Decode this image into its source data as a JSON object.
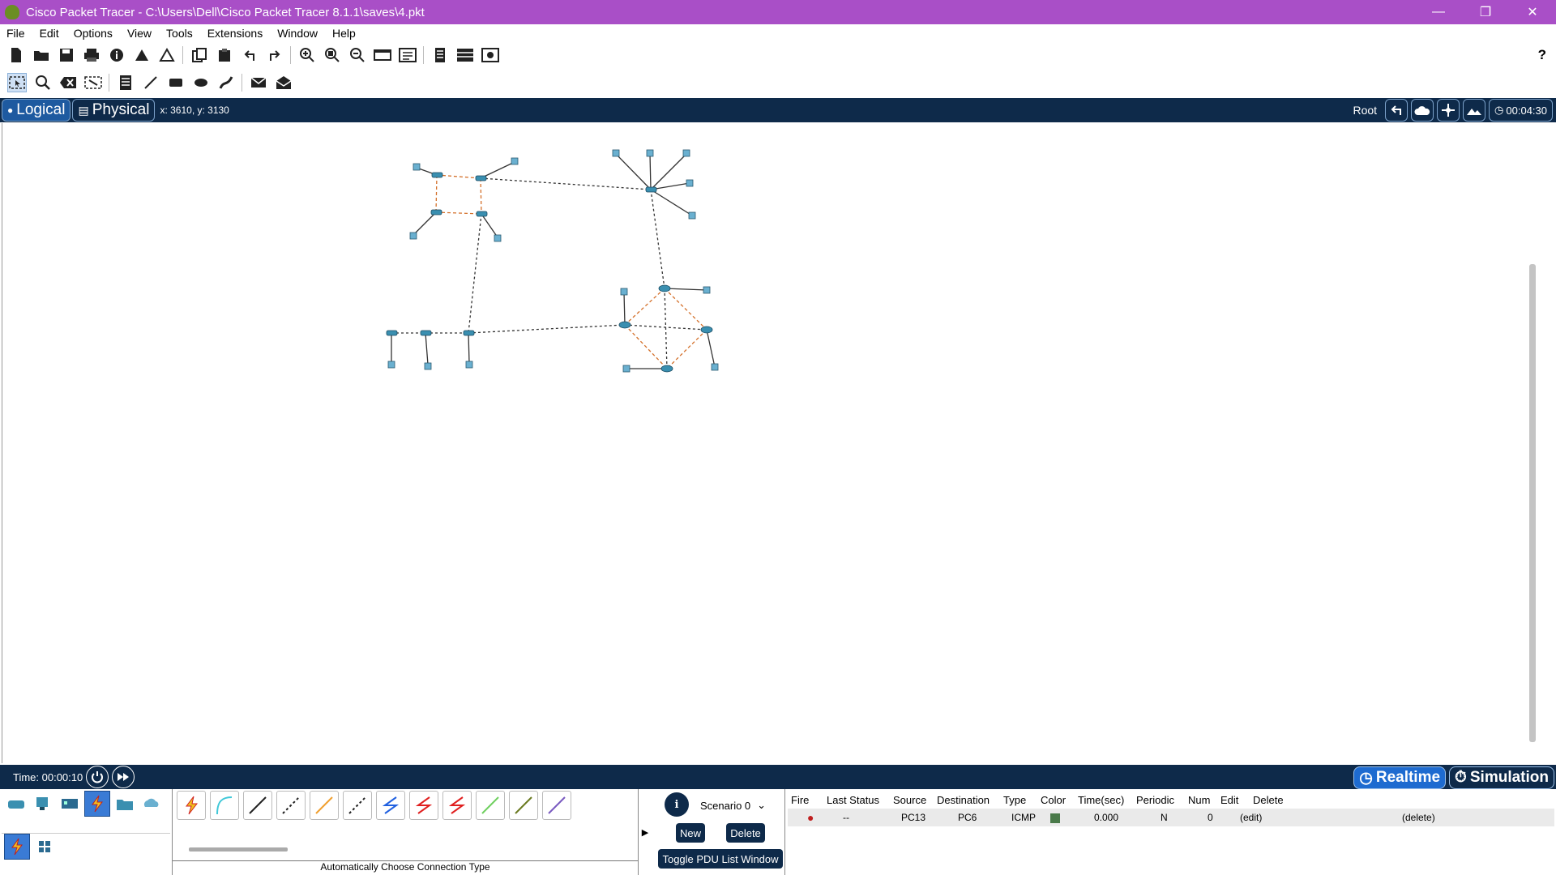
{
  "window": {
    "title": "Cisco Packet Tracer - C:\\Users\\Dell\\Cisco Packet Tracer 8.1.1\\saves\\4.pkt",
    "controls": [
      "—",
      "❐",
      "✕"
    ]
  },
  "menu": [
    "File",
    "Edit",
    "Options",
    "View",
    "Tools",
    "Extensions",
    "Window",
    "Help"
  ],
  "toolbar_main": {
    "icons": [
      "new-file-icon",
      "open-folder-icon",
      "save-icon",
      "print-icon",
      "info-icon",
      "network-wizard-icon",
      "activity-wizard-icon",
      "copy-icon",
      "paste-icon",
      "undo-icon",
      "redo-icon",
      "zoom-in-icon",
      "zoom-reset-icon",
      "zoom-out-icon",
      "drawing-palette-icon",
      "custom-device-icon",
      "cluster-icon",
      "table-icon",
      "viewport-icon"
    ],
    "help": "?"
  },
  "toolbar_edit": {
    "icons": [
      "select-icon",
      "inspect-icon",
      "delete-icon",
      "resize-icon",
      "note-icon",
      "line-draw-icon",
      "rectangle-icon",
      "ellipse-icon",
      "freeform-icon",
      "simple-pdu-icon",
      "complex-pdu-icon"
    ]
  },
  "nav": {
    "logical": "Logical",
    "physical": "Physical",
    "coords": "x: 3610, y: 3130",
    "root": "Root",
    "clock": "00:04:30"
  },
  "status": {
    "time": "Time: 00:00:10",
    "realtime": "Realtime",
    "simulation": "Simulation"
  },
  "devices": {
    "categories": [
      "network-devices-icon",
      "end-devices-icon",
      "components-icon",
      "connections-icon",
      "miscellaneous-icon",
      "multiuser-icon"
    ],
    "selected": "connections-icon"
  },
  "connections": {
    "types": [
      {
        "name": "auto-connection",
        "color": "#e8a020"
      },
      {
        "name": "console",
        "color": "#40c8d8"
      },
      {
        "name": "copper-straight",
        "color": "#222222"
      },
      {
        "name": "copper-cross",
        "color": "#222222"
      },
      {
        "name": "fiber",
        "color": "#f0a030"
      },
      {
        "name": "phone",
        "color": "#222222"
      },
      {
        "name": "coaxial",
        "color": "#2060e0"
      },
      {
        "name": "serial-dce",
        "color": "#e02020"
      },
      {
        "name": "serial-dte",
        "color": "#e02020"
      },
      {
        "name": "octal",
        "color": "#70d060"
      },
      {
        "name": "iot-custom",
        "color": "#6a7a20"
      },
      {
        "name": "usb",
        "color": "#7a5ac0"
      }
    ],
    "label": "Automatically Choose Connection Type"
  },
  "scenario": {
    "name": "Scenario 0",
    "new": "New",
    "delete": "Delete",
    "toggle": "Toggle PDU List Window"
  },
  "pdu_list": {
    "headers": [
      "Fire",
      "Last Status",
      "Source",
      "Destination",
      "Type",
      "Color",
      "Time(sec)",
      "Periodic",
      "Num",
      "Edit",
      "Delete"
    ],
    "rows": [
      {
        "fire": "●",
        "last_status": "--",
        "source": "PC13",
        "destination": "PC6",
        "type": "ICMP",
        "color": "#4a7a4a",
        "time": "0.000",
        "periodic": "N",
        "num": "0",
        "edit": "(edit)",
        "delete": "(delete)"
      }
    ]
  }
}
